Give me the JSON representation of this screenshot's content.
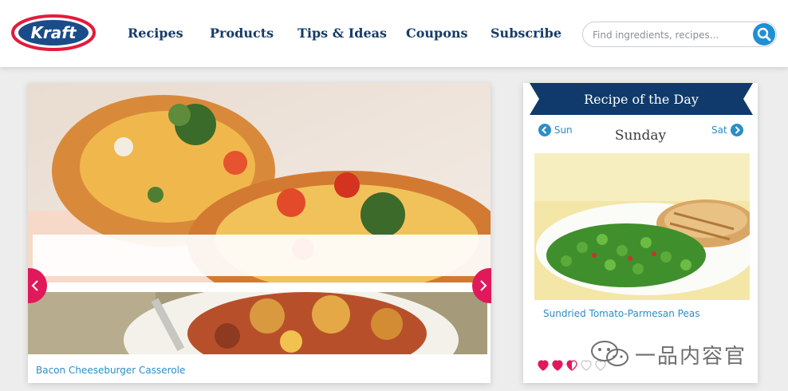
{
  "header": {
    "logo_text": "Kraft",
    "nav": [
      "Recipes",
      "Products",
      "Tips & Ideas",
      "Coupons",
      "Subscribe"
    ],
    "search_placeholder": "Find ingredients, recipes...",
    "search_icon": "magnifier-icon"
  },
  "hero": {
    "caption": "Bacon Cheeseburger Casserole",
    "prev_icon": "chevron-left-icon",
    "next_icon": "chevron-right-icon"
  },
  "recipe_of_the_day": {
    "title": "Recipe of the Day",
    "prev_day": "Sun",
    "next_day": "Sat",
    "current_day": "Sunday",
    "recipe_name": "Sundried Tomato-Parmesan Peas",
    "rating": 2.5,
    "rating_max": 5
  },
  "watermark": {
    "text": "一品内容官"
  },
  "colors": {
    "brand_red": "#e0195a",
    "nav_navy": "#163c68",
    "link_blue": "#2b8ec6",
    "banner_navy": "#0f3a6b"
  }
}
